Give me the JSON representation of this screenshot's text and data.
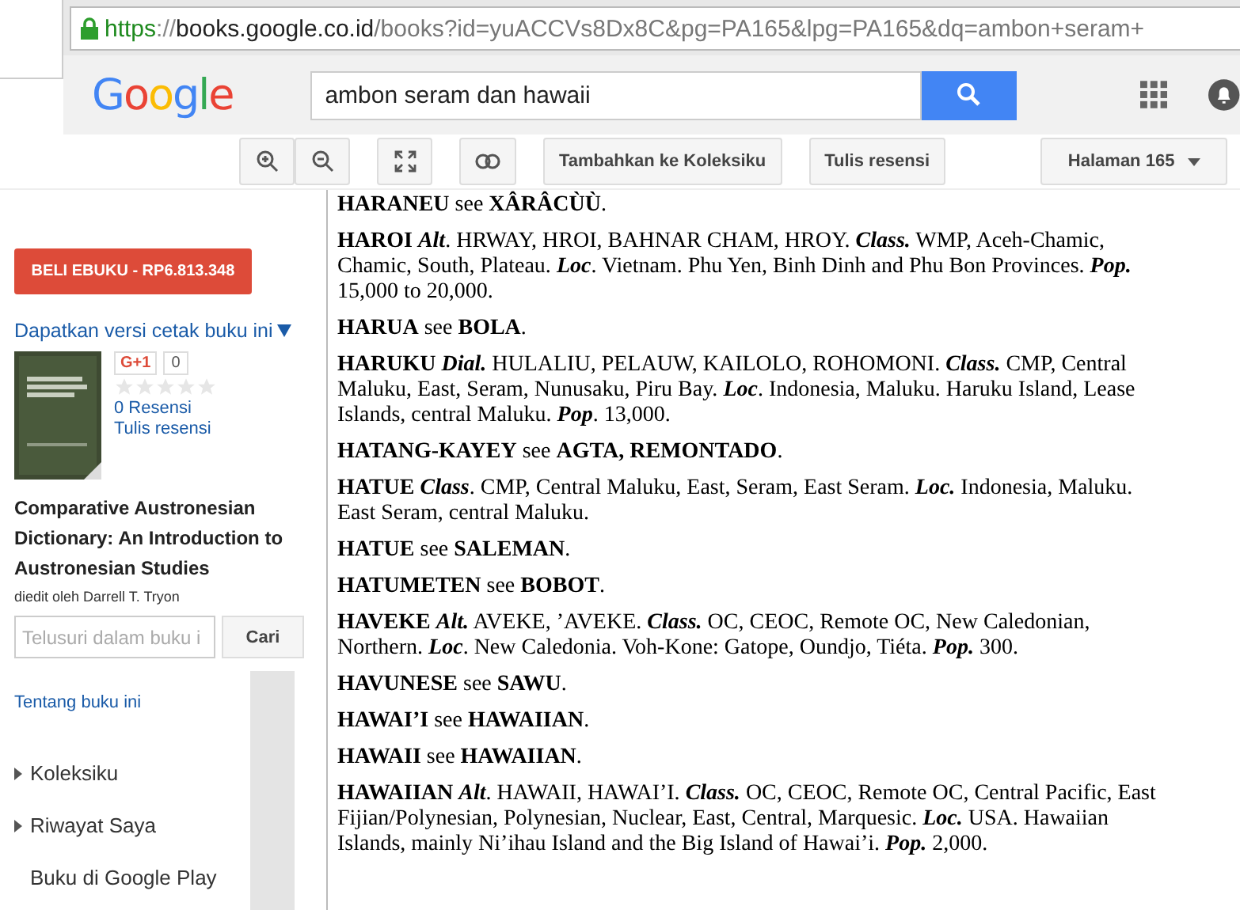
{
  "address_bar": {
    "scheme": "https",
    "separator": "://",
    "host": "books.google.co.id",
    "path": "/books?id=yuACCVs8Dx8C&pg=PA165&lpg=PA165&dq=ambon+seram+"
  },
  "search": {
    "value": "ambon seram dan hawaii"
  },
  "logo": "Google",
  "toolbar": {
    "buttons": [
      "Tambahkan ke Koleksiku",
      "Tulis resensi"
    ],
    "page_select": "Halaman 165"
  },
  "sidebar": {
    "buy_button": "BELI EBUKU - RP6.813.348",
    "print_link": "Dapatkan versi cetak buku ini",
    "plus_one": "G+1",
    "plus_count": "0",
    "stars": 0,
    "reviews_link": "0 Resensi",
    "write_review_link": "Tulis resensi",
    "book_title": "Comparative Austronesian Dictionary: An Introduction to Austronesian Studies",
    "editor": "diedit oleh Darrell T. Tryon",
    "search_placeholder": "Telusuri dalam buku i",
    "search_button": "Cari",
    "about_link": "Tentang buku ini",
    "menu": [
      {
        "label": "Koleksiku",
        "expandable": true
      },
      {
        "label": "Riwayat Saya",
        "expandable": true
      },
      {
        "label": "Buku di Google Play",
        "expandable": false
      }
    ]
  },
  "entries": [
    "**HARANEU** see **XÂRÂCÙÙ**.",
    "**HAROI** *Alt*. HRWAY, HROI, BAHNAR CHAM, HROY. *Class.* WMP, Aceh-Chamic, Chamic, South, Plateau. *Loc*. Vietnam. Phu Yen, Binh Dinh and Phu Bon Provinces. *Pop.* 15,000 to 20,000.",
    "**HARUA**  see **BOLA**.",
    "**HARUKU** *Dial.* HULALIU, PELAUW, KAILOLO, ROHOMONI. *Class.* CMP, Central Maluku, East, Seram, Nunusaku, Piru Bay. *Loc*. Indonesia, Maluku. Haruku Island, Lease Islands, central Maluku. *Pop*. 13,000.",
    "**HATANG-KAYEY** see **AGTA, REMONTADO**.",
    "**HATUE** *Class*. CMP, Central Maluku, East, Seram, East Seram. *Loc.* Indonesia, Maluku. East Seram, central Maluku.",
    "**HATUE** see **SALEMAN**.",
    "**HATUMETEN** see **BOBOT**.",
    "**HAVEKE** *Alt.* AVEKE, ’AVEKE. *Class.* OC, CEOC, Remote OC, New Caledonian, Northern. *Loc*. New Caledonia. Voh-Kone: Gatope, Oundjo, Tiéta. *Pop.* 300.",
    "**HAVUNESE** see **SAWU**.",
    "**HAWAI’I** see **HAWAIIAN**.",
    "**HAWAII** see **HAWAIIAN**.",
    "**HAWAIIAN** *Alt*. HAWAII, HAWAI’I. *Class.* OC, CEOC, Remote OC, Central Pacific, East Fijian/Polynesian,  Polynesian, Nuclear, East, Central, Marquesic. *Loc.* USA. Hawaiian Islands, mainly Ni’ihau Island and the Big Island of  Hawai’i. *Pop.* 2,000."
  ]
}
